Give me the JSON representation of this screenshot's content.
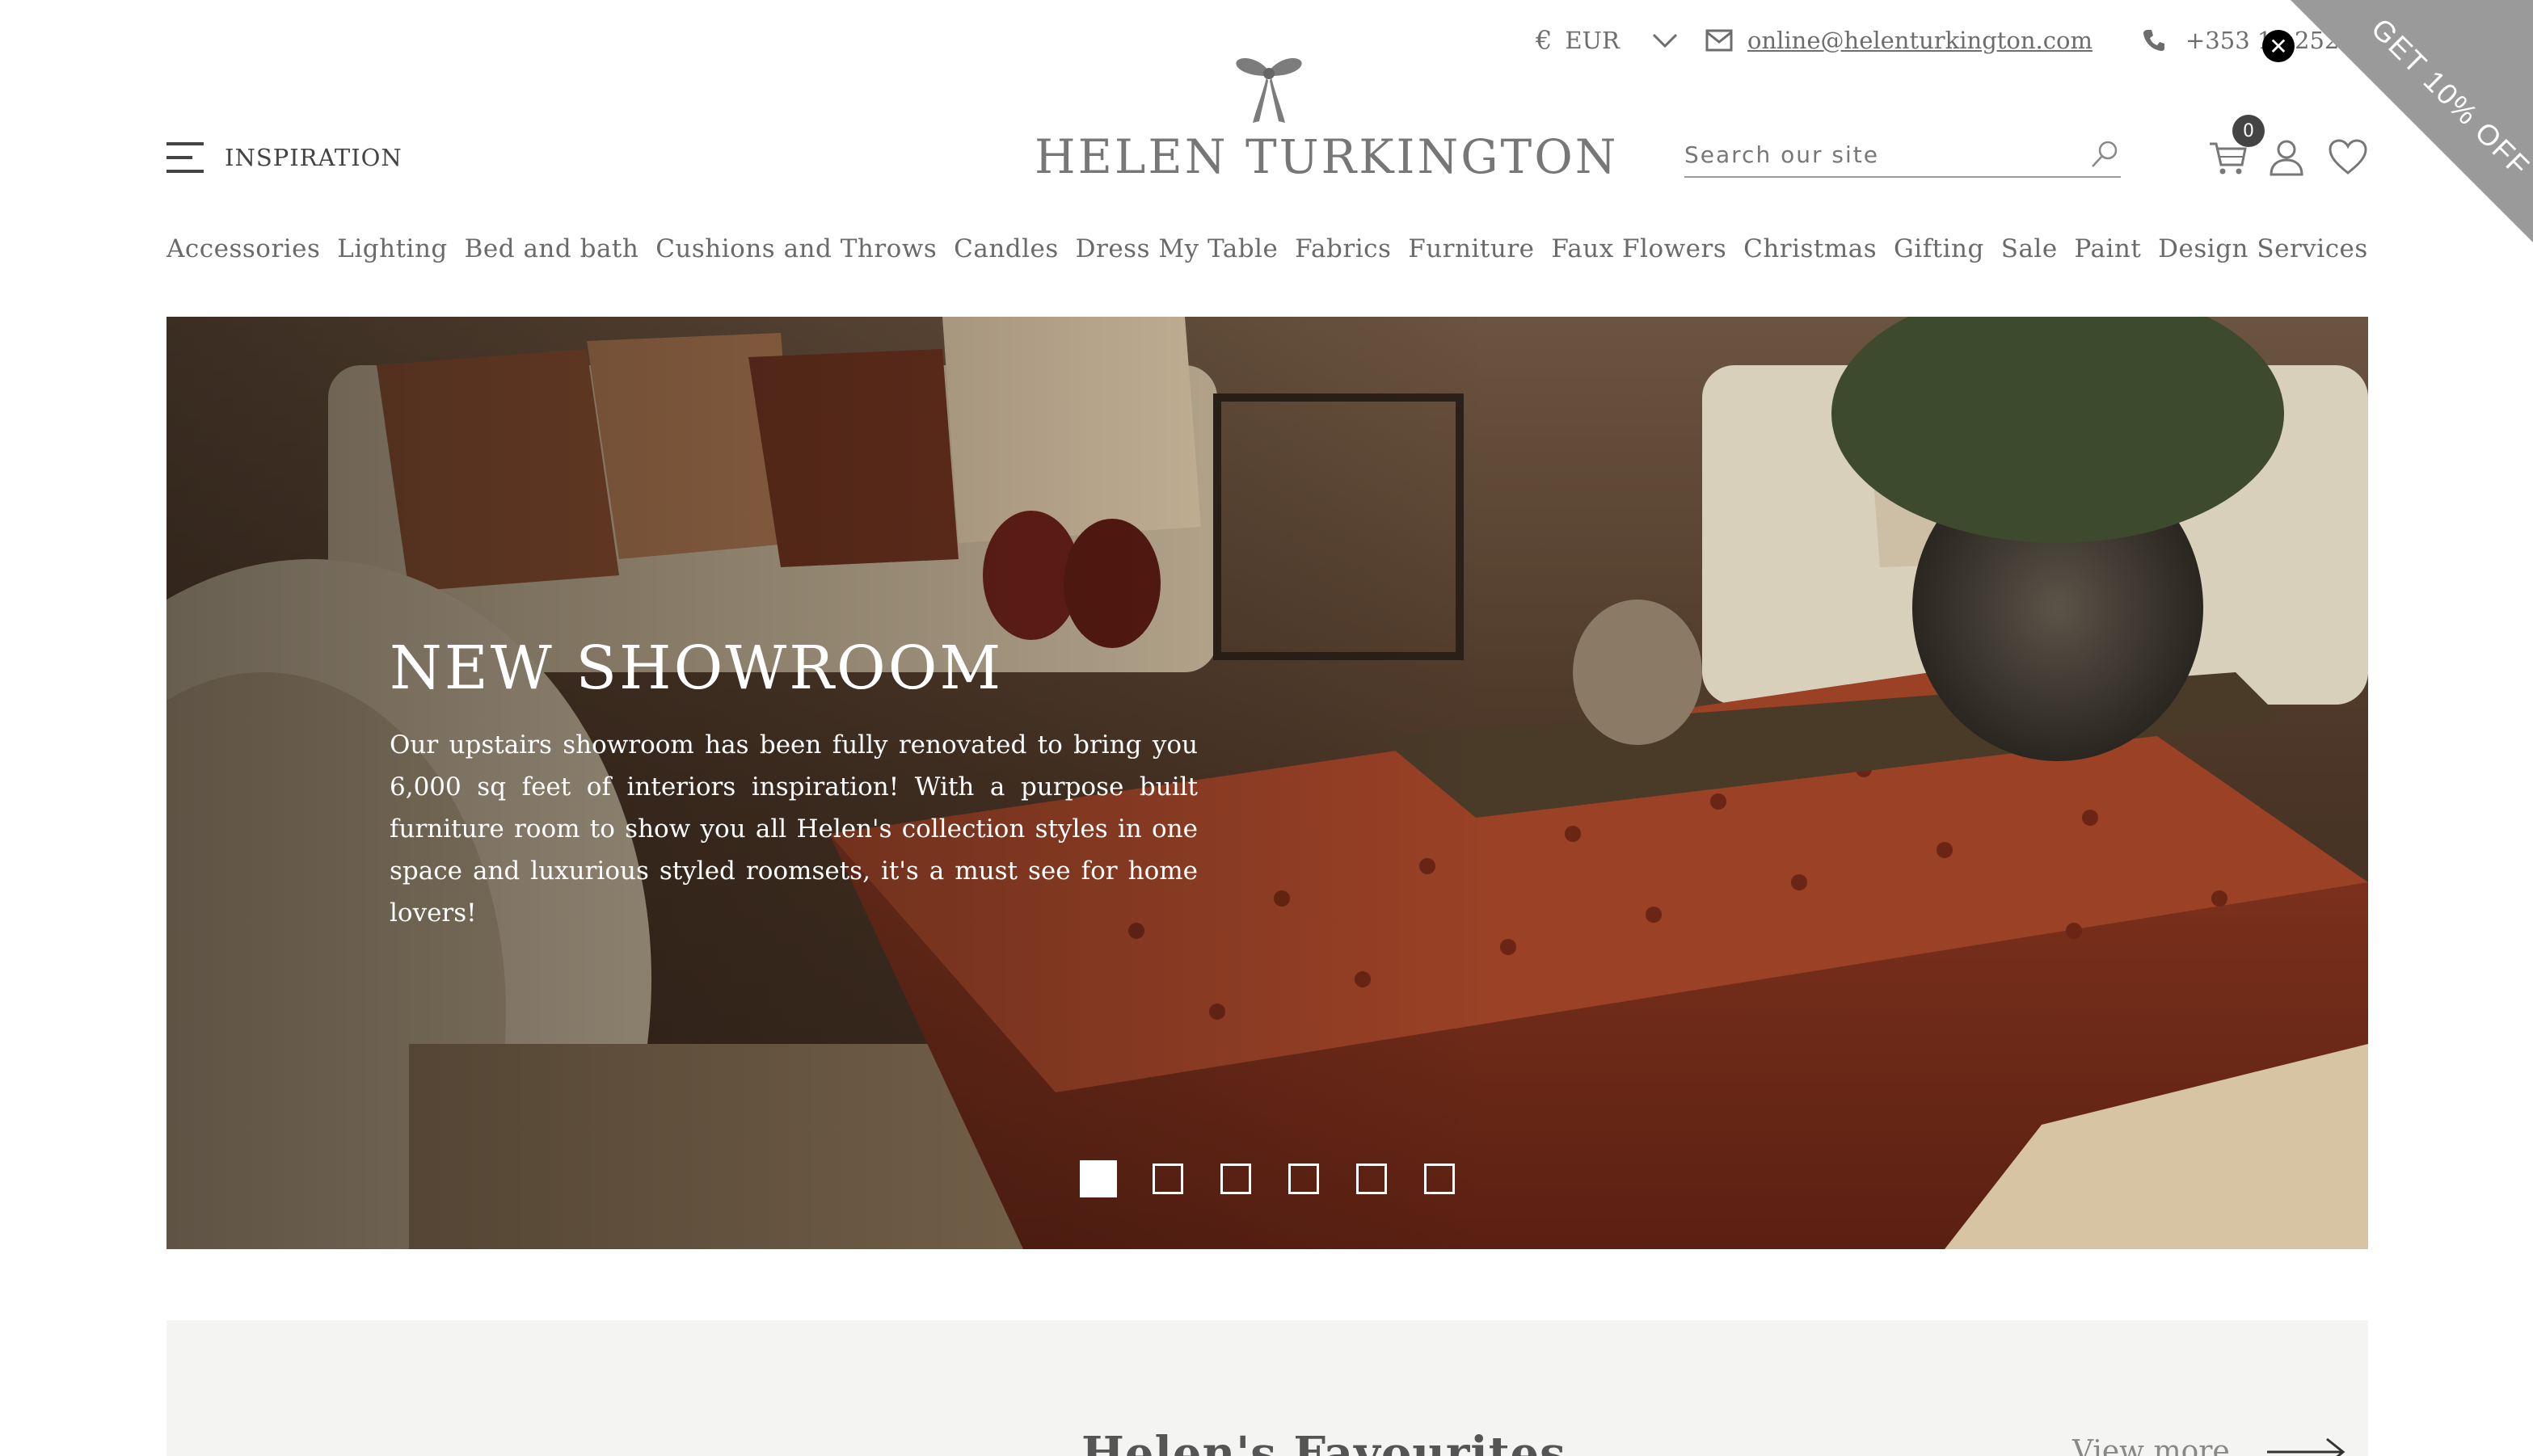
{
  "utility_bar": {
    "currency_symbol": "€",
    "currency": "EUR",
    "email": "online@helenturkington.com",
    "phone": "+353 12 252"
  },
  "promo": {
    "corner_text": "GET 10% OFF",
    "close_glyph": "✕"
  },
  "header": {
    "menu_label": "INSPIRATION",
    "logo_text": "HELEN TURKINGTON",
    "search_placeholder": "Search our site",
    "cart_count": "0"
  },
  "nav": {
    "items": [
      "Accessories",
      "Lighting",
      "Bed and bath",
      "Cushions and Throws",
      "Candles",
      "Dress My Table",
      "Fabrics",
      "Furniture",
      "Faux Flowers",
      "Christmas",
      "Gifting",
      "Sale",
      "Paint",
      "Design Services"
    ]
  },
  "hero": {
    "title": "NEW SHOWROOM",
    "text": "Our upstairs showroom has been fully renovated to bring you 6,000 sq feet of interiors inspiration! With a purpose built furniture room to show you all Helen's collection styles in one space and luxurious styled roomsets, it's a must see for home lovers!",
    "slide_count": 6,
    "active_slide": 1
  },
  "favourites": {
    "title": "Helen's Favourites",
    "view_more": "View more"
  },
  "colors": {
    "promo_grey": "#9a9a9a",
    "text_grey": "#6a6a6a",
    "strip_bg": "#f4f4f2",
    "ottoman_rust": "#7a2c18"
  },
  "icons": [
    "currency-chevron-icon",
    "envelope-icon",
    "phone-icon",
    "close-icon",
    "menu-icon",
    "bow-logo-icon",
    "search-icon",
    "cart-icon",
    "account-icon",
    "heart-icon",
    "arrow-right-icon"
  ]
}
